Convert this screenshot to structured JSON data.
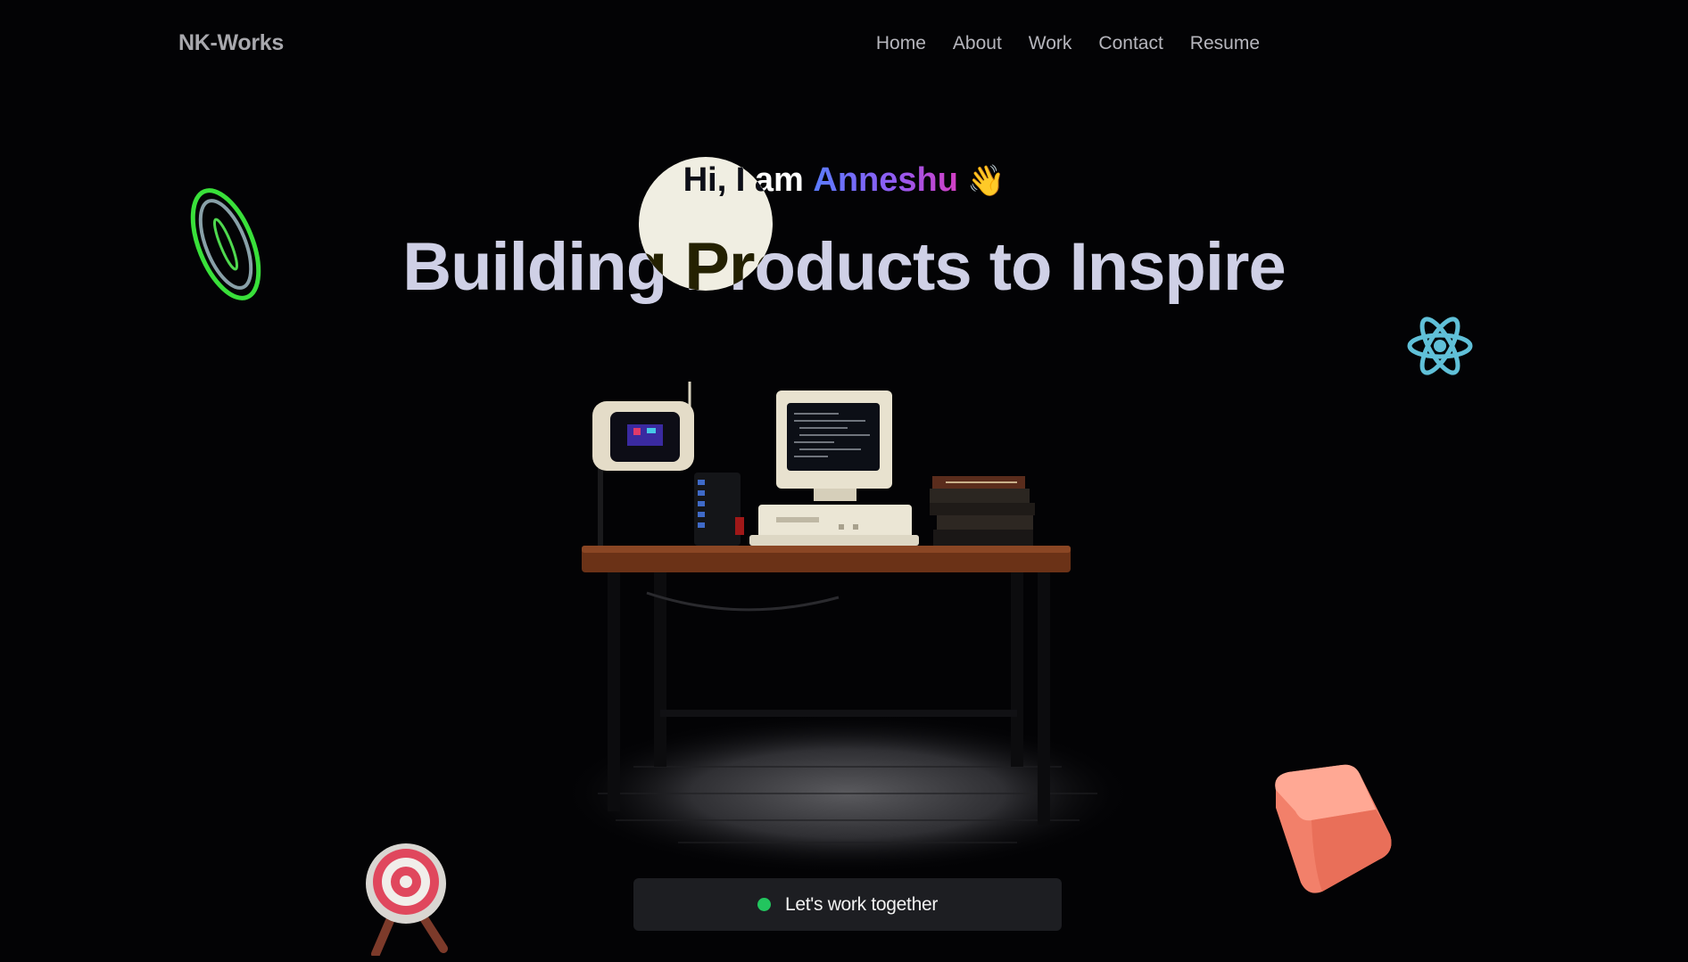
{
  "brand": {
    "logo": "NK-Works"
  },
  "nav": {
    "items": [
      {
        "label": "Home"
      },
      {
        "label": "About"
      },
      {
        "label": "Work"
      },
      {
        "label": "Contact"
      },
      {
        "label": "Resume"
      }
    ]
  },
  "hero": {
    "greeting_prefix": "Hi, I am ",
    "greeting_name": "Anneshu",
    "greeting_emoji": "👋",
    "headline": "Building Products to Inspire"
  },
  "cta": {
    "label": "Let's work together",
    "status_color": "#22c55e"
  },
  "icons": [
    "ring-icon",
    "react-icon",
    "target-icon",
    "cube-icon"
  ],
  "colors": {
    "background": "#030305",
    "headline": "#cfd0e6",
    "name_gradient": [
      "#5a7cff",
      "#8f5cf2",
      "#d33fc4"
    ]
  }
}
